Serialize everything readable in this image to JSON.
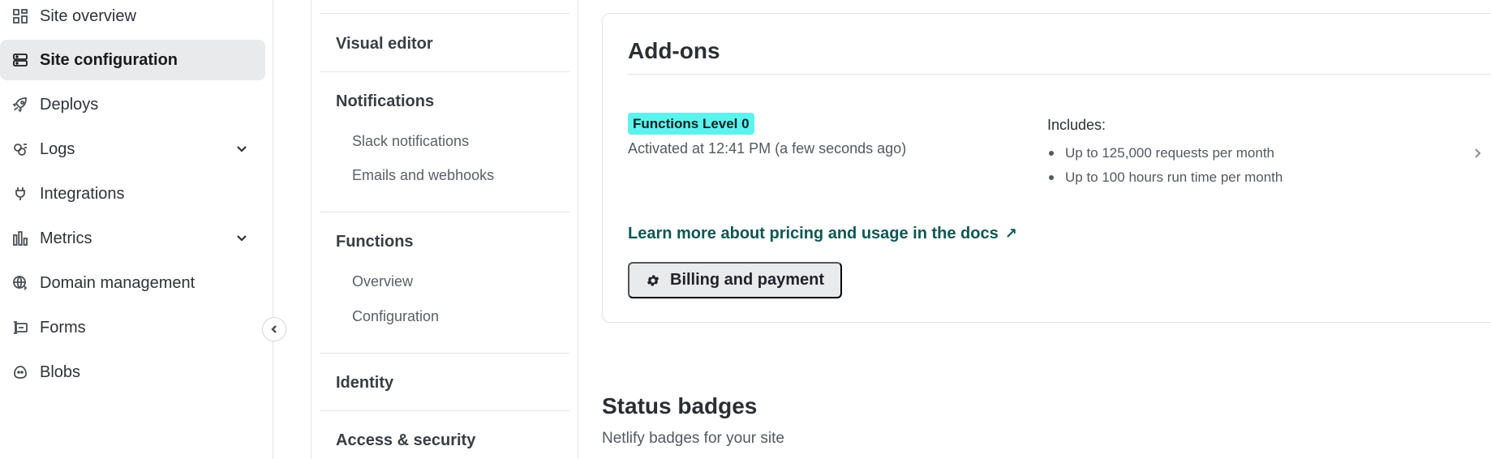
{
  "sidebar": {
    "items": [
      {
        "label": "Site overview",
        "icon": "grid-icon"
      },
      {
        "label": "Site configuration",
        "icon": "server-icon",
        "active": true
      },
      {
        "label": "Deploys",
        "icon": "rocket-icon"
      },
      {
        "label": "Logs",
        "icon": "logs-icon",
        "expandable": true
      },
      {
        "label": "Integrations",
        "icon": "plug-icon"
      },
      {
        "label": "Metrics",
        "icon": "bar-chart-icon",
        "expandable": true
      },
      {
        "label": "Domain management",
        "icon": "globe-icon"
      },
      {
        "label": "Forms",
        "icon": "form-icon"
      },
      {
        "label": "Blobs",
        "icon": "blob-icon"
      }
    ]
  },
  "subnav": {
    "visual_editor": "Visual editor",
    "notifications": "Notifications",
    "slack_notifications": "Slack notifications",
    "emails_webhooks": "Emails and webhooks",
    "functions": "Functions",
    "functions_overview": "Overview",
    "functions_configuration": "Configuration",
    "identity": "Identity",
    "access_security": "Access & security"
  },
  "addons": {
    "title": "Add-ons",
    "badge": "Functions Level 0",
    "activated": "Activated at 12:41 PM (a few seconds ago)",
    "includes_label": "Includes:",
    "includes": [
      "Up to 125,000 requests per month",
      "Up to 100 hours run time per month"
    ],
    "docs_link": "Learn more about pricing and usage in the docs",
    "docs_link_arrow": "↗",
    "billing_button": "Billing and payment"
  },
  "status_badges": {
    "title": "Status badges",
    "subtitle": "Netlify badges for your site"
  },
  "colors": {
    "badge_bg": "#5ef2ee",
    "link": "#0e5753",
    "active_nav_bg": "#e9eaec"
  }
}
